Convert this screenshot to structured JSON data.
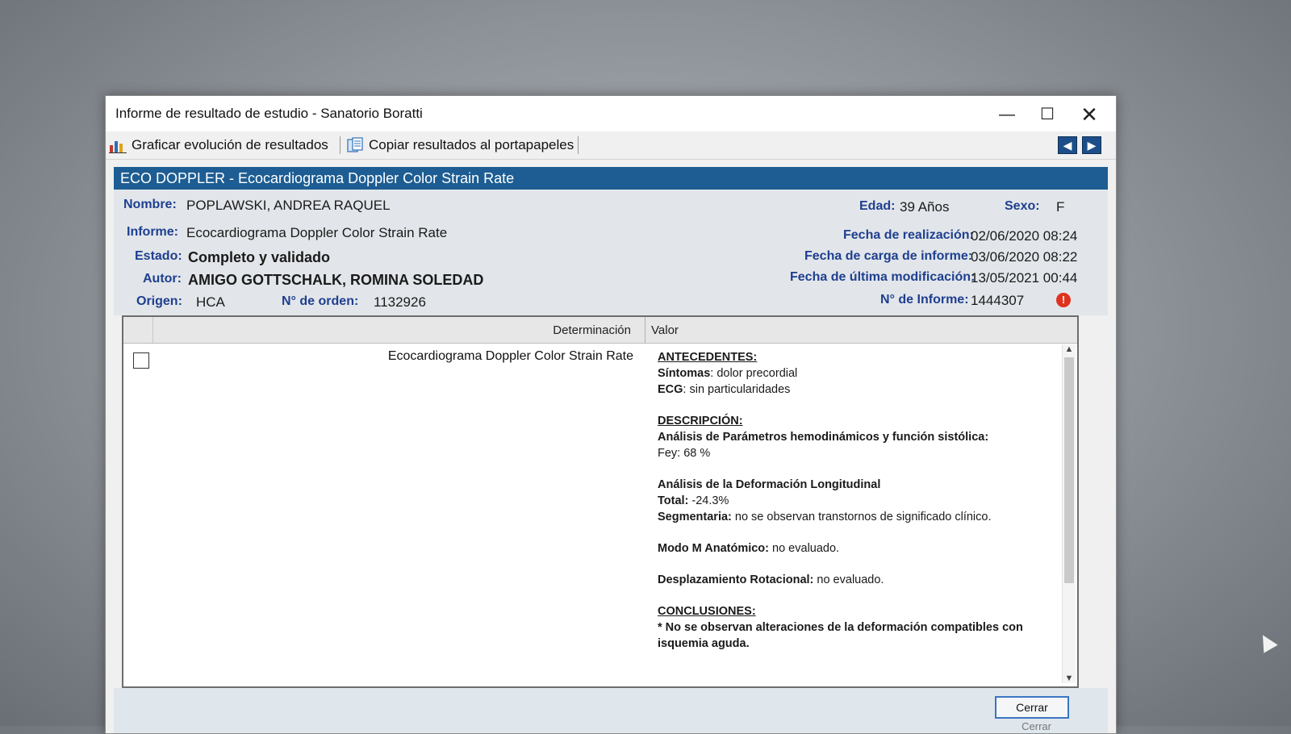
{
  "window": {
    "title": "Informe de resultado de estudio - Sanatorio Boratti",
    "controls": {
      "minimize": "—",
      "maximize": "☐",
      "close": "✕"
    }
  },
  "toolbar": {
    "graph_label": "Graficar evolución de resultados",
    "copy_label": "Copiar resultados al portapapeles",
    "nav_prev": "◀",
    "nav_next": "▶"
  },
  "header": {
    "title": "ECO DOPPLER - Ecocardiograma Doppler Color Strain Rate"
  },
  "patient": {
    "nombre_label": "Nombre:",
    "nombre": "POPLAWSKI, ANDREA RAQUEL",
    "edad_label": "Edad:",
    "edad": "39 Años",
    "sexo_label": "Sexo:",
    "sexo": "F",
    "informe_label": "Informe:",
    "informe": "Ecocardiograma Doppler Color Strain Rate",
    "estado_label": "Estado:",
    "estado": "Completo y validado",
    "autor_label": "Autor:",
    "autor": "AMIGO GOTTSCHALK, ROMINA SOLEDAD",
    "origen_label": "Origen:",
    "origen": "HCA",
    "orden_label": "N° de orden:",
    "orden": "1132926",
    "fecha_realizacion_label": "Fecha de realización:",
    "fecha_realizacion": "02/06/2020 08:24",
    "fecha_carga_label": "Fecha de carga de informe:",
    "fecha_carga": "03/06/2020 08:22",
    "fecha_mod_label": "Fecha de última modificación:",
    "fecha_mod": "13/05/2021 00:44",
    "nro_informe_label": "N° de Informe:",
    "nro_informe": "1444307",
    "alert_glyph": "!"
  },
  "table": {
    "col_determinacion": "Determinación",
    "col_valor": "Valor",
    "row": {
      "determinacion": "Ecocardiograma Doppler Color Strain Rate",
      "antecedentes_title": "ANTECEDENTES:",
      "sintomas_label": "Síntomas",
      "sintomas": ": dolor precordial",
      "ecg_label": "ECG",
      "ecg": ": sin particularidades",
      "descripcion_title": "DESCRIPCIÓN:",
      "analisis_params": "Análisis de Parámetros hemodinámicos  y función sistólica:",
      "fey": "Fey: 68 %",
      "analisis_deform": "Análisis de la Deformación Longitudinal",
      "total_label": "Total:",
      "total": " -24.3%",
      "segmentaria_label": "Segmentaria:",
      "segmentaria": " no se observan transtornos de significado clínico.",
      "modo_m_label": "Modo M Anatómico:",
      "modo_m": " no evaluado.",
      "desplazamiento_label": "Desplazamiento Rotacional:",
      "desplazamiento": " no evaluado.",
      "conclusiones_title": "CONCLUSIONES:",
      "conclusion": "* No se observan alteraciones de la deformación compatibles con isquemia aguda."
    },
    "scroll_up": "▲",
    "scroll_down": "▼"
  },
  "footer": {
    "close_label": "Cerrar",
    "ghost_label": "Cerrar"
  }
}
